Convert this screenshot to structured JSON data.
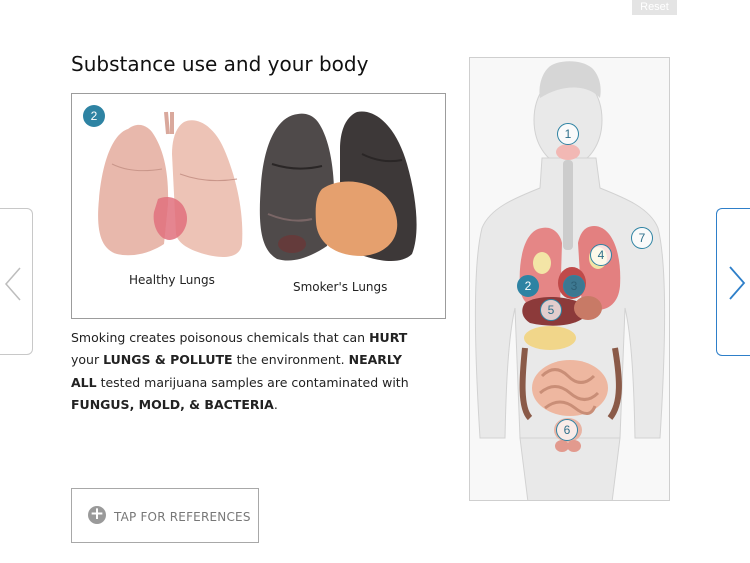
{
  "header": {
    "reset_label": "Reset"
  },
  "page": {
    "title": "Substance use and your body"
  },
  "image_panel": {
    "badge": "2",
    "healthy_caption": "Healthy Lungs",
    "smoker_caption": "Smoker's Lungs"
  },
  "description": {
    "t1": "Smoking creates poisonous chemicals that can ",
    "b1": "HURT",
    "t2": "your ",
    "b2": "LUNGS & POLLUTE",
    "t3": " the environment. ",
    "b3": "NEARLY ALL",
    "t4": " tested marijuana samples are contaminated with ",
    "b4": "FUNGUS, MOLD, & BACTERIA",
    "t5": "."
  },
  "references": {
    "label": "TAP FOR REFERENCES"
  },
  "body_map": {
    "markers": [
      "1",
      "2",
      "3",
      "4",
      "5",
      "6",
      "7"
    ]
  }
}
